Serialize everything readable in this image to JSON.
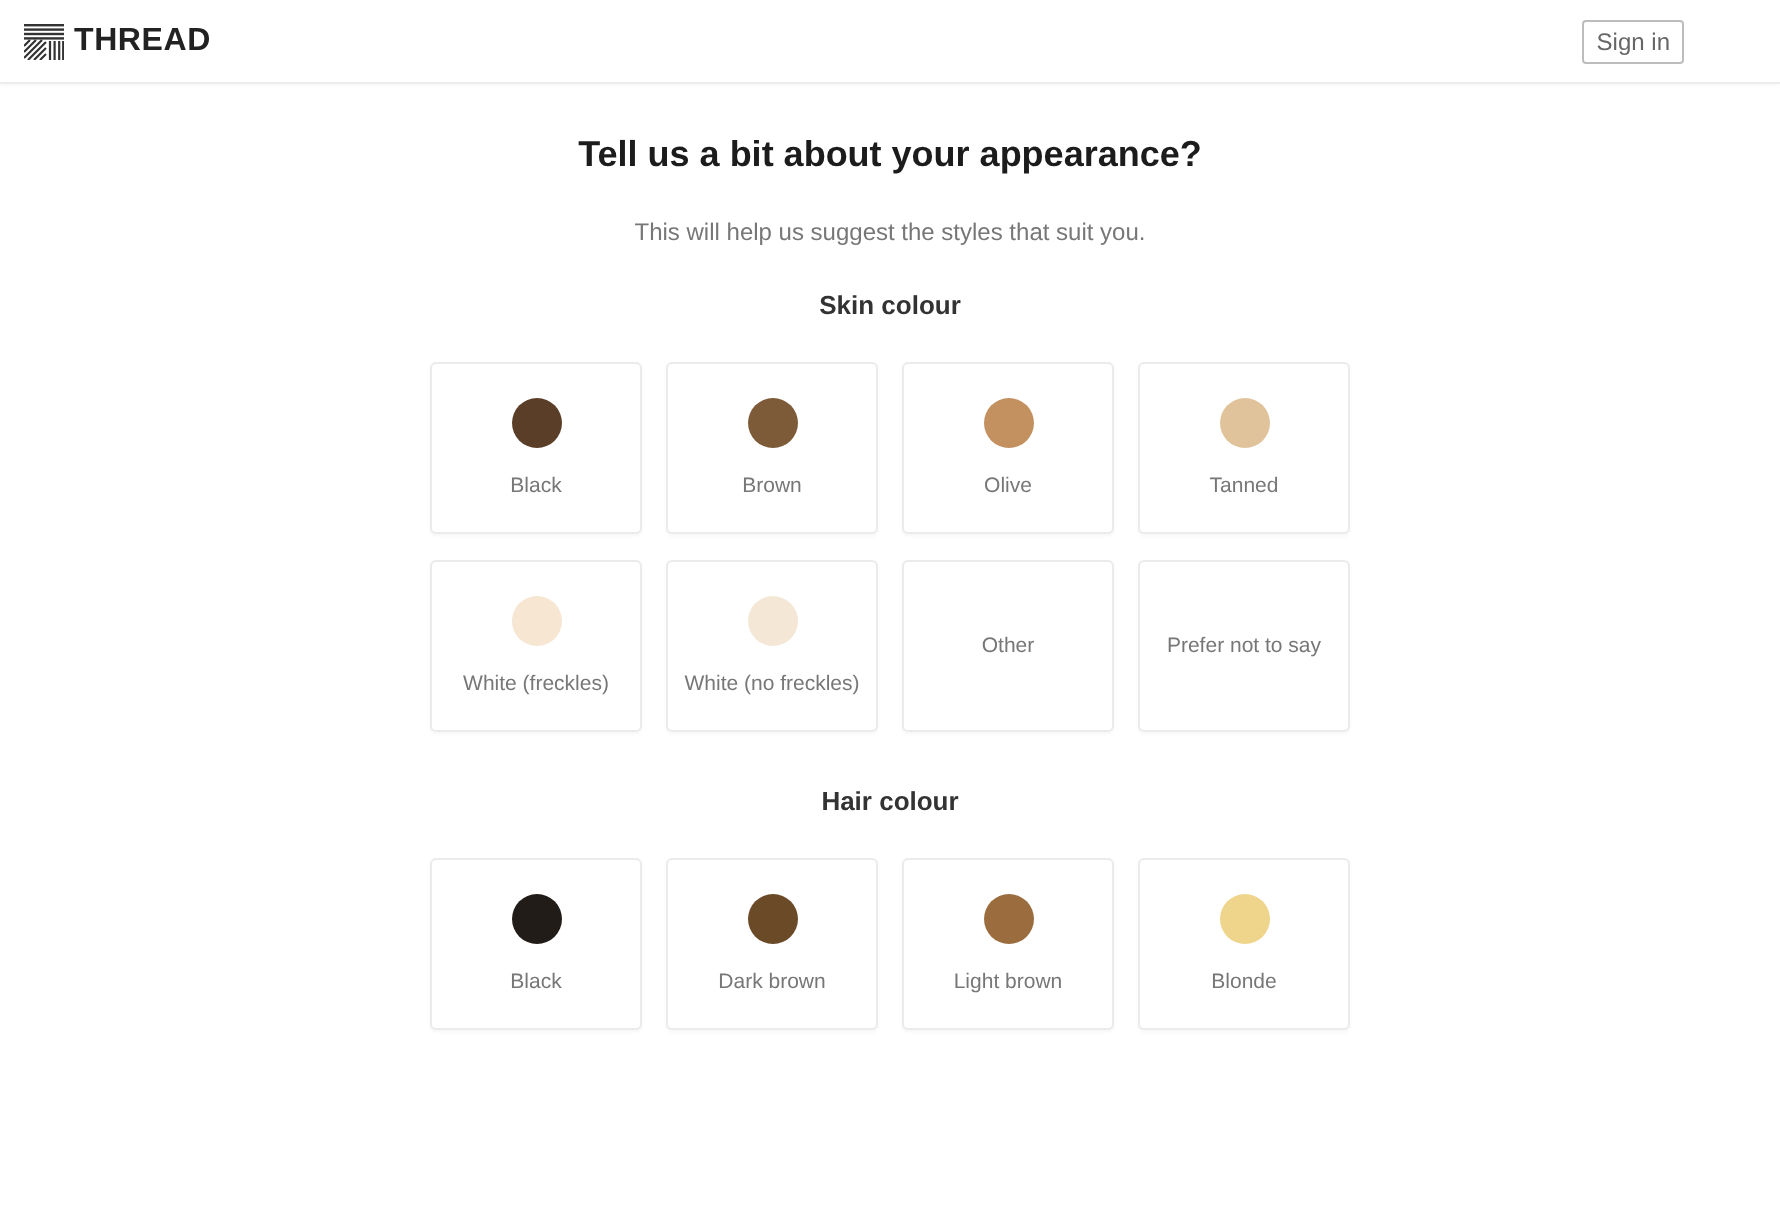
{
  "header": {
    "logo": "THREAD",
    "sign_in": "Sign in"
  },
  "heading": "Tell us a bit about your appearance?",
  "subtitle": "This will help us suggest the styles that suit you.",
  "sections": [
    {
      "title": "Skin colour",
      "options": [
        {
          "kind": "swatch",
          "label": "Black",
          "color": "#5a3e28",
          "selected": false
        },
        {
          "kind": "swatch",
          "label": "Brown",
          "color": "#7e5b38",
          "selected": false
        },
        {
          "kind": "swatch",
          "label": "Olive",
          "color": "#c39060",
          "selected": false
        },
        {
          "kind": "swatch",
          "label": "Tanned",
          "color": "#e0c39b",
          "selected": false
        },
        {
          "kind": "swatch",
          "label": "White (freckles)",
          "color": "#f6e6d2",
          "selected": false
        },
        {
          "kind": "swatch",
          "label": "White (no freckles)",
          "color": "#f5e7d6",
          "selected": false
        },
        {
          "kind": "plain",
          "label": "Other",
          "selected": false
        },
        {
          "kind": "plain",
          "label": "Prefer not to say",
          "selected": false
        }
      ]
    },
    {
      "title": "Hair colour",
      "options": [
        {
          "kind": "swatch",
          "label": "Black",
          "color": "#211c18",
          "selected": false
        },
        {
          "kind": "swatch",
          "label": "Dark brown",
          "color": "#6b4a28",
          "selected": false
        },
        {
          "kind": "swatch",
          "label": "Light brown",
          "color": "#9b6d3e",
          "selected": false
        },
        {
          "kind": "swatch",
          "label": "Blonde",
          "color": "#efd58c",
          "selected": false
        }
      ]
    }
  ]
}
